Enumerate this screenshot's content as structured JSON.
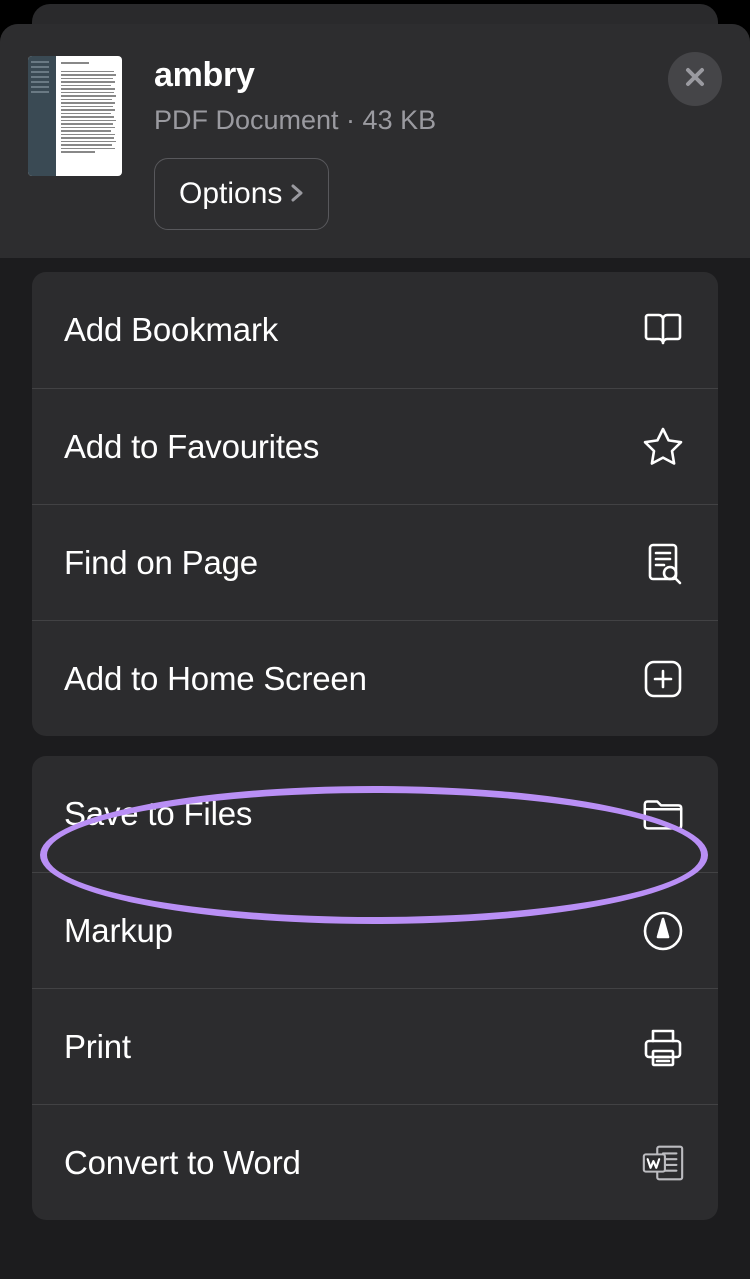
{
  "file": {
    "name": "ambry",
    "subtitle": "PDF Document · 43 KB",
    "options_label": "Options"
  },
  "groups": [
    {
      "rows": [
        {
          "label": "Add Bookmark",
          "icon": "book-icon",
          "name": "add-bookmark"
        },
        {
          "label": "Add to Favourites",
          "icon": "star-icon",
          "name": "add-to-favourites"
        },
        {
          "label": "Find on Page",
          "icon": "find-icon",
          "name": "find-on-page"
        },
        {
          "label": "Add to Home Screen",
          "icon": "plus-square-icon",
          "name": "add-to-home-screen"
        }
      ]
    },
    {
      "rows": [
        {
          "label": "Save to Files",
          "icon": "folder-icon",
          "name": "save-to-files",
          "highlighted": true
        },
        {
          "label": "Markup",
          "icon": "markup-icon",
          "name": "markup"
        },
        {
          "label": "Print",
          "icon": "print-icon",
          "name": "print"
        },
        {
          "label": "Convert to Word",
          "icon": "word-icon",
          "name": "convert-to-word"
        }
      ]
    }
  ]
}
